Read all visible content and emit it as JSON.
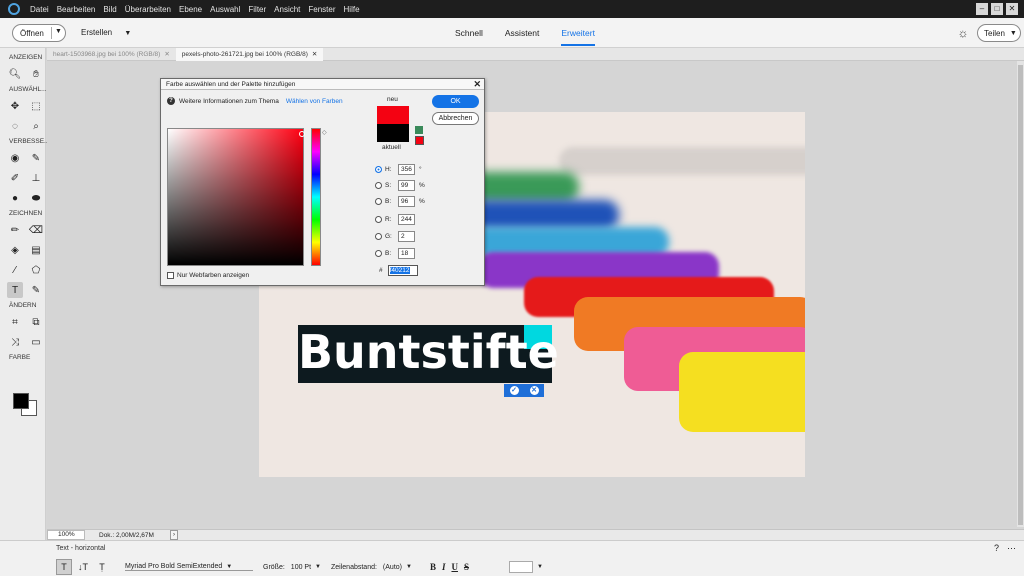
{
  "menubar": {
    "items": [
      "Datei",
      "Bearbeiten",
      "Bild",
      "Überarbeiten",
      "Ebene",
      "Auswahl",
      "Filter",
      "Ansicht",
      "Fenster",
      "Hilfe"
    ]
  },
  "modebar": {
    "open_label": "Öffnen",
    "create_label": "Erstellen",
    "tabs": [
      "Schnell",
      "Assistent",
      "Erweitert"
    ],
    "active_tab": "Erweitert",
    "share_label": "Teilen"
  },
  "toolbox": {
    "sections": [
      "ANZEIGEN",
      "AUSWÄHL...",
      "VERBESSE...",
      "ZEICHNEN",
      "ÄNDERN",
      "FARBE"
    ]
  },
  "document_tabs": [
    {
      "label": "heart-1503968.jpg bei 100% (RGB/8)"
    },
    {
      "label": "pexels-photo-261721.jpg bei 100% (RGB/8)"
    }
  ],
  "canvas": {
    "text_layer": "Buntstifte"
  },
  "statusbar": {
    "zoom": "100%",
    "doc_size": "Dok.: 2,00M/2,67M"
  },
  "options": {
    "title": "Text - horizontal",
    "font": "Myriad Pro Bold SemiExtended",
    "size_label": "Größe:",
    "size_value": "100 Pt",
    "leading_label": "Zeilenabstand:",
    "leading_value": "(Auto)",
    "format_buttons": [
      "B",
      "I",
      "U",
      "S"
    ]
  },
  "dialog": {
    "title": "Farbe auswählen und der Palette hinzufügen",
    "info_text": "Weitere Informationen zum Thema",
    "info_link": "Wählen von Farben",
    "new_label": "neu",
    "current_label": "aktuell",
    "ok_label": "OK",
    "cancel_label": "Abbrechen",
    "web_colors_label": "Nur Webfarben anzeigen",
    "fields": {
      "H": {
        "label": "H:",
        "value": "356",
        "unit": "°"
      },
      "S": {
        "label": "S:",
        "value": "99",
        "unit": "%"
      },
      "B": {
        "label": "B:",
        "value": "96",
        "unit": "%"
      },
      "R": {
        "label": "R:",
        "value": "244"
      },
      "G": {
        "label": "G:",
        "value": "2"
      },
      "B2": {
        "label": "B:",
        "value": "18"
      }
    },
    "hex_label": "#",
    "hex_value": "f40212",
    "new_color": "#f40212",
    "current_color": "#000000"
  },
  "colors": {
    "accent": "#1473e6",
    "foreground": "#000000",
    "background": "#ffffff"
  }
}
